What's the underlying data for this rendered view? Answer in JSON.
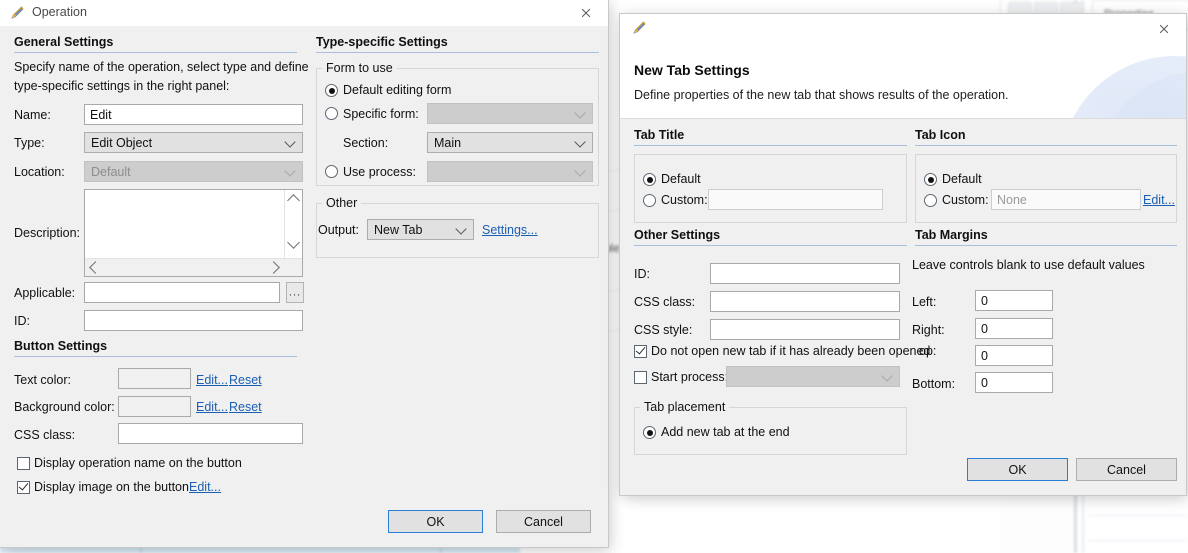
{
  "background": {
    "note": "blurred application window behind the dialogs"
  },
  "operation_dialog": {
    "title": "Operation",
    "icon": "app-icon",
    "close_icon": "close-icon",
    "general": {
      "header": "General Settings",
      "intro_line1": "Specify name of the operation, select type and define",
      "intro_line2": "type-specific settings in the right panel:",
      "name_label": "Name:",
      "name_value": "Edit",
      "type_label": "Type:",
      "type_value": "Edit Object",
      "location_label": "Location:",
      "location_value": "Default",
      "description_label": "Description:",
      "description_value": "",
      "applicable_label": "Applicable:",
      "applicable_value": "",
      "browse_label": "...",
      "id_label": "ID:",
      "id_value": ""
    },
    "button_settings": {
      "header": "Button Settings",
      "text_color_label": "Text color:",
      "text_color_value": "",
      "text_color_edit": "Edit...",
      "text_color_reset": "Reset",
      "background_color_label": "Background color:",
      "background_color_value": "",
      "background_color_edit": "Edit...",
      "background_color_reset": "Reset",
      "css_class_label": "CSS class:",
      "css_class_value": "",
      "display_name_label": "Display operation name on the button",
      "display_name_checked": false,
      "display_image_label": "Display image on the button",
      "display_image_checked": true,
      "display_image_edit": "Edit..."
    },
    "type_specific": {
      "header": "Type-specific Settings",
      "form_group_caption": "Form to use",
      "default_form_label": "Default editing form",
      "default_form_selected": true,
      "specific_form_label": "Specific form:",
      "specific_form_selected": false,
      "specific_form_value": "",
      "section_label": "Section:",
      "section_value": "Main",
      "use_process_label": "Use process:",
      "use_process_selected": false,
      "use_process_value": "",
      "other_group_caption": "Other",
      "output_label": "Output:",
      "output_value": "New Tab",
      "output_settings_link": "Settings..."
    },
    "footer": {
      "ok_label": "OK",
      "cancel_label": "Cancel"
    }
  },
  "new_tab_dialog": {
    "icon": "app-icon",
    "close_icon": "close-icon",
    "heading": "New Tab Settings",
    "subheading": "Define properties of the new tab that shows results of the operation.",
    "tab_title": {
      "header": "Tab Title",
      "default_label": "Default",
      "default_selected": true,
      "custom_label": "Custom:",
      "custom_selected": false,
      "custom_value": ""
    },
    "tab_icon": {
      "header": "Tab Icon",
      "default_label": "Default",
      "default_selected": true,
      "custom_label": "Custom:",
      "custom_selected": false,
      "custom_value": "None",
      "edit_link": "Edit..."
    },
    "other_settings": {
      "header": "Other Settings",
      "id_label": "ID:",
      "id_value": "",
      "css_class_label": "CSS class:",
      "css_class_value": "",
      "css_style_label": "CSS style:",
      "css_style_value": "",
      "do_not_open_label": "Do not open new tab if it has already been opened",
      "do_not_open_checked": true,
      "start_process_label": "Start process:",
      "start_process_checked": false,
      "start_process_value": "",
      "tab_placement_caption": "Tab placement",
      "add_at_end_label": "Add new tab at the end",
      "add_at_end_selected": true
    },
    "tab_margins": {
      "header": "Tab Margins",
      "hint": "Leave controls blank to use default values",
      "left_label": "Left:",
      "left_value": "0",
      "right_label": "Right:",
      "right_value": "0",
      "top_label": "op:",
      "top_value": "0",
      "bottom_label": "Bottom:",
      "bottom_value": "0"
    },
    "footer": {
      "ok_label": "OK",
      "cancel_label": "Cancel"
    }
  },
  "colors": {
    "dialog_bg": "#f0f0f0",
    "section_rule": "#a8c0dd",
    "link": "#1a5fb4",
    "default_button_border": "#2a7fd4"
  }
}
